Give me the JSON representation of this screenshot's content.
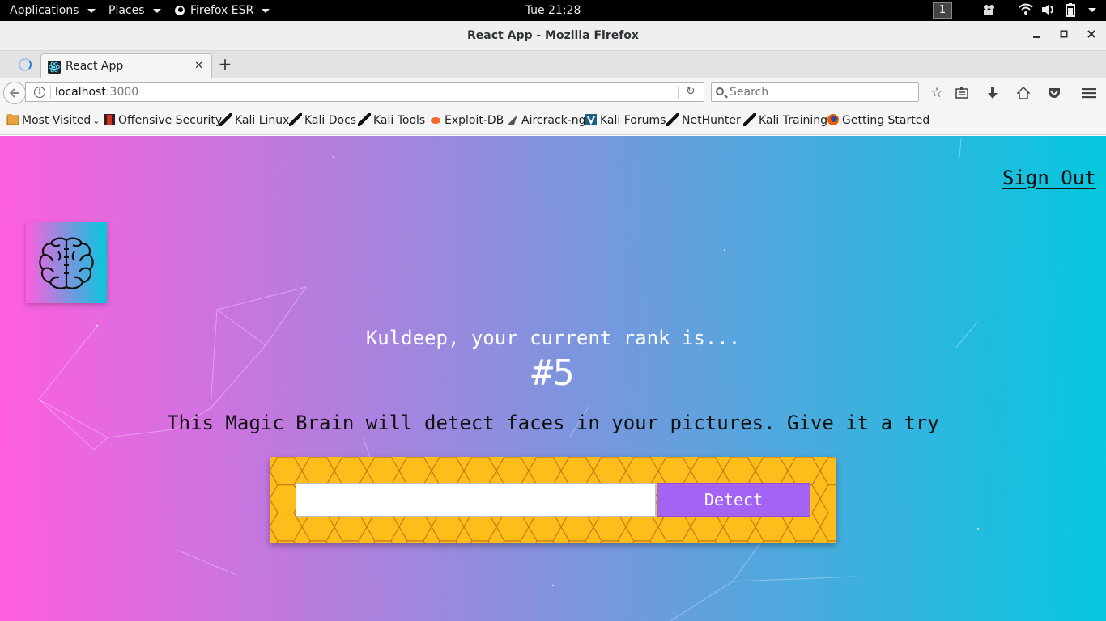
{
  "system_bar": {
    "applications": "Applications",
    "places": "Places",
    "app": "Firefox ESR",
    "clock": "Tue 21:28",
    "workspace": "1"
  },
  "window": {
    "title": "React App - Mozilla Firefox"
  },
  "tabs": [
    {
      "label": "React App",
      "active": true
    }
  ],
  "navbar": {
    "url_host": "localhost",
    "url_port": ":3000",
    "search_placeholder": "Search"
  },
  "bookmarks": {
    "most_visited": "Most Visited",
    "items": [
      "Offensive Security",
      "Kali Linux",
      "Kali Docs",
      "Kali Tools",
      "Exploit-DB",
      "Aircrack-ng",
      "Kali Forums",
      "NetHunter",
      "Kali Training",
      "Getting Started"
    ]
  },
  "app": {
    "sign_out": "Sign Out",
    "rank_message": "Kuldeep, your current rank is...",
    "rank": "#5",
    "tagline": "This Magic Brain will detect faces in your pictures. Give it a try",
    "input_value": "",
    "detect_label": "Detect"
  },
  "colors": {
    "gradient_start": "#ff5edf",
    "gradient_end": "#04c8de",
    "button": "#a463f2",
    "panel": "#ffbd1b"
  },
  "icons": [
    "brain-icon",
    "react-favicon",
    "search-icon",
    "bookmark-star-icon",
    "reading-list-icon",
    "download-icon",
    "home-icon",
    "pocket-icon",
    "menu-icon"
  ]
}
